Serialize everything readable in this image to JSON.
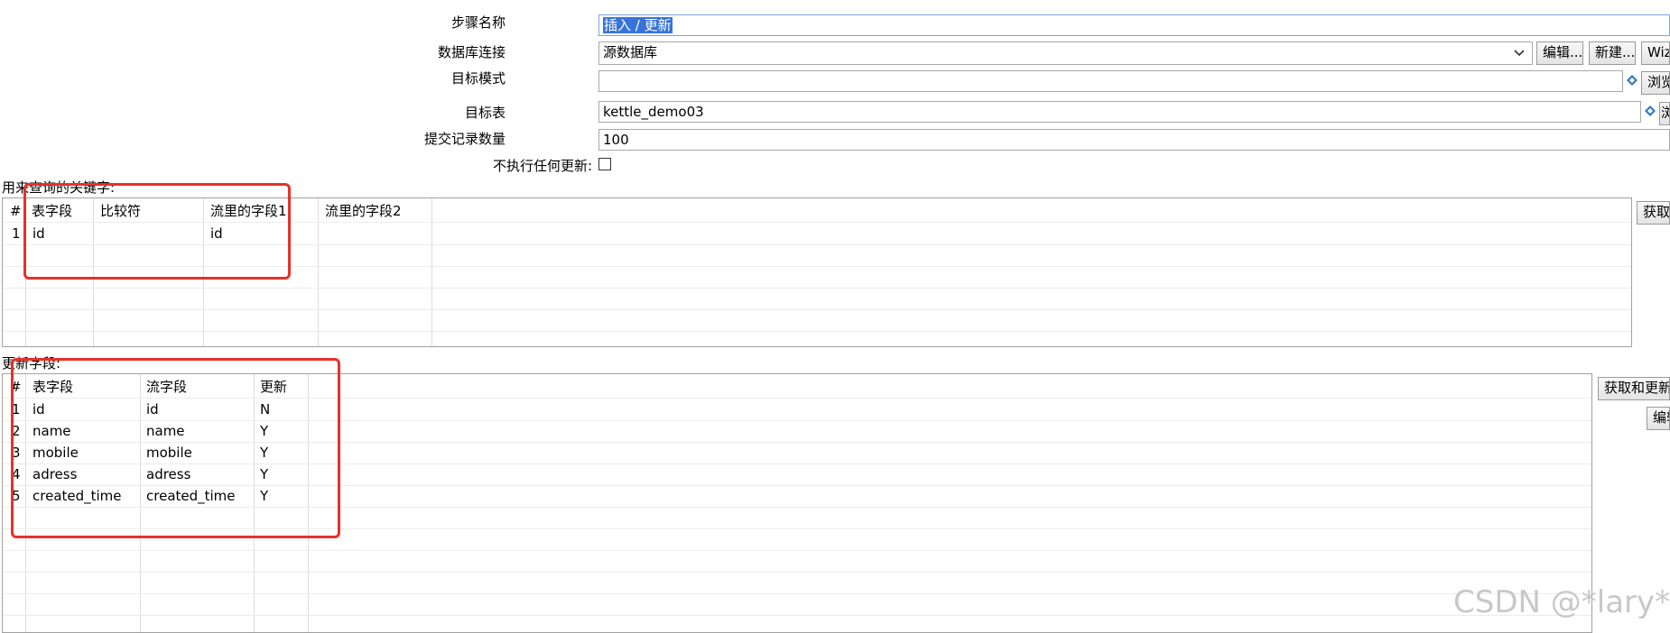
{
  "form": {
    "step_name": {
      "label": "步骤名称",
      "value": "插入 / 更新"
    },
    "db_connection": {
      "label": "数据库连接",
      "value": "源数据库",
      "edit_button": "编辑...",
      "new_button": "新建...",
      "wizard_button": "Wiz"
    },
    "target_schema": {
      "label": "目标模式",
      "value": "",
      "browse_button": "浏览"
    },
    "target_table": {
      "label": "目标表",
      "value": "kettle_demo03",
      "browse_button": "浏"
    },
    "commit_size": {
      "label": "提交记录数量",
      "value": "100"
    },
    "no_update": {
      "label": "不执行任何更新:",
      "checked": false
    }
  },
  "lookup_keys": {
    "title": "用来查询的关键字:",
    "get_fields_button": "获取",
    "columns": [
      "#",
      "表字段",
      "比较符",
      "流里的字段1",
      "流里的字段2"
    ],
    "rows": [
      [
        "1",
        "id",
        "",
        "id",
        ""
      ]
    ]
  },
  "update_fields": {
    "title": "更新字段:",
    "get_update_button": "获取和更新",
    "edit_mapping_button": "编辑",
    "columns": [
      "#",
      "表字段",
      "流字段",
      "更新"
    ],
    "rows": [
      [
        "1",
        "id",
        "id",
        "N"
      ],
      [
        "2",
        "name",
        "name",
        "Y"
      ],
      [
        "3",
        "mobile",
        "mobile",
        "Y"
      ],
      [
        "4",
        "adress",
        "adress",
        "Y"
      ],
      [
        "5",
        "created_time",
        "created_time",
        "Y"
      ]
    ]
  },
  "watermark": "CSDN @*lary*",
  "colors": {
    "highlight_box": "#e8302a",
    "selection": "#3874d8"
  }
}
